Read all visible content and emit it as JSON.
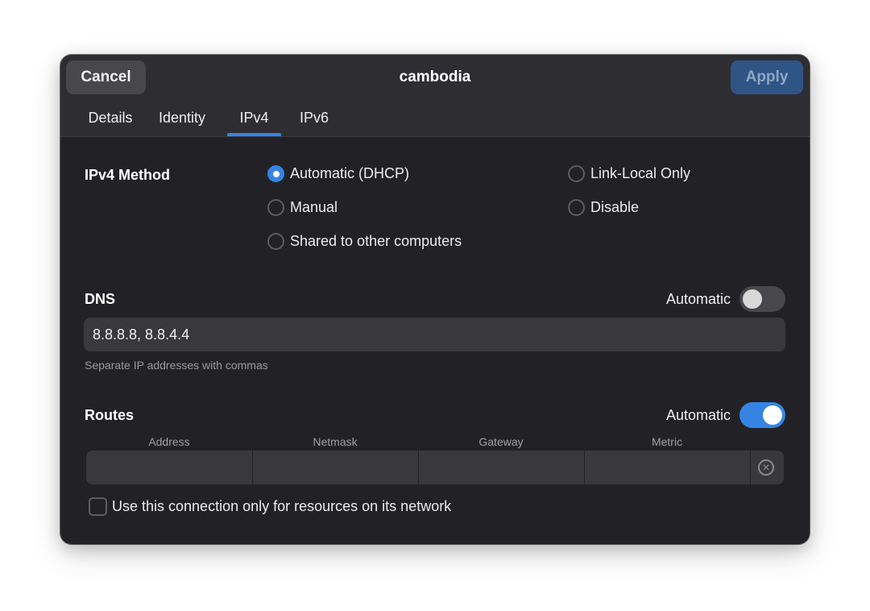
{
  "header": {
    "cancel_label": "Cancel",
    "title": "cambodia",
    "apply_label": "Apply"
  },
  "tabs": [
    {
      "label": "Details",
      "active": false
    },
    {
      "label": "Identity",
      "active": false
    },
    {
      "label": "IPv4",
      "active": true
    },
    {
      "label": "IPv6",
      "active": false
    }
  ],
  "ipv4_method": {
    "label": "IPv4 Method",
    "options": [
      {
        "label": "Automatic (DHCP)",
        "selected": true
      },
      {
        "label": "Link-Local Only",
        "selected": false
      },
      {
        "label": "Manual",
        "selected": false
      },
      {
        "label": "Disable",
        "selected": false
      },
      {
        "label": "Shared to other computers",
        "selected": false
      }
    ]
  },
  "dns": {
    "label": "DNS",
    "automatic_label": "Automatic",
    "automatic_on": false,
    "value": "8.8.8.8, 8.8.4.4",
    "hint": "Separate IP addresses with commas"
  },
  "routes": {
    "label": "Routes",
    "automatic_label": "Automatic",
    "automatic_on": true,
    "columns": [
      "Address",
      "Netmask",
      "Gateway",
      "Metric"
    ]
  },
  "only_local_resources": {
    "label": "Use this connection only for resources on its network",
    "checked": false
  },
  "colors": {
    "accent": "#3584e4",
    "dialog_bg": "#222226",
    "header_bg": "#2e2e32"
  }
}
